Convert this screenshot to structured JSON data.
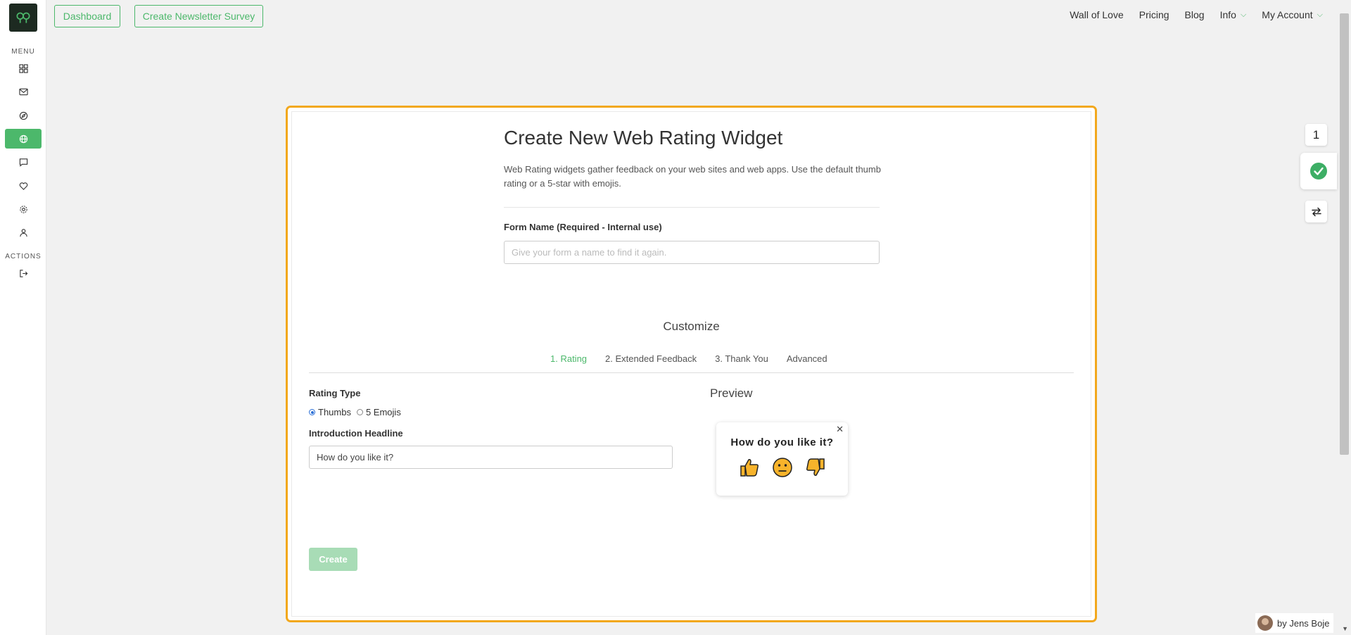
{
  "sidebar": {
    "menu_label": "MENU",
    "actions_label": "ACTIONS",
    "items": [
      {
        "icon": "grid-icon"
      },
      {
        "icon": "mail-icon"
      },
      {
        "icon": "compass-icon"
      },
      {
        "icon": "globe-icon",
        "active": true
      },
      {
        "icon": "chat-icon"
      },
      {
        "icon": "heart-icon"
      },
      {
        "icon": "gear-icon"
      },
      {
        "icon": "user-icon"
      }
    ],
    "actions": [
      {
        "icon": "logout-icon"
      }
    ]
  },
  "topnav": {
    "dashboard": "Dashboard",
    "create_newsletter_survey": "Create Newsletter Survey",
    "links": {
      "wall_of_love": "Wall of Love",
      "pricing": "Pricing",
      "blog": "Blog",
      "info": "Info",
      "my_account": "My Account"
    }
  },
  "page": {
    "title": "Create New Web Rating Widget",
    "description": "Web Rating widgets gather feedback on your web sites and web apps. Use the default thumb rating or a 5-star with emojis.",
    "form_name_label": "Form Name (Required - Internal use)",
    "form_name_placeholder": "Give your form a name to find it again.",
    "customize_heading": "Customize",
    "tabs": [
      "1. Rating",
      "2. Extended Feedback",
      "3. Thank You",
      "Advanced"
    ],
    "active_tab": "1. Rating",
    "rating_type_label": "Rating Type",
    "rating_options": [
      "Thumbs",
      "5 Emojis"
    ],
    "selected_rating": "Thumbs",
    "intro_headline_label": "Introduction Headline",
    "intro_headline_value": "How do you like it?",
    "preview_title": "Preview",
    "widget": {
      "question": "How do you like it?",
      "close": "✕"
    },
    "create_button": "Create"
  },
  "floating": {
    "count": "1"
  },
  "byline": "by Jens Boje",
  "colors": {
    "accent": "#4cb86b",
    "highlight_border": "#f2a81d"
  }
}
